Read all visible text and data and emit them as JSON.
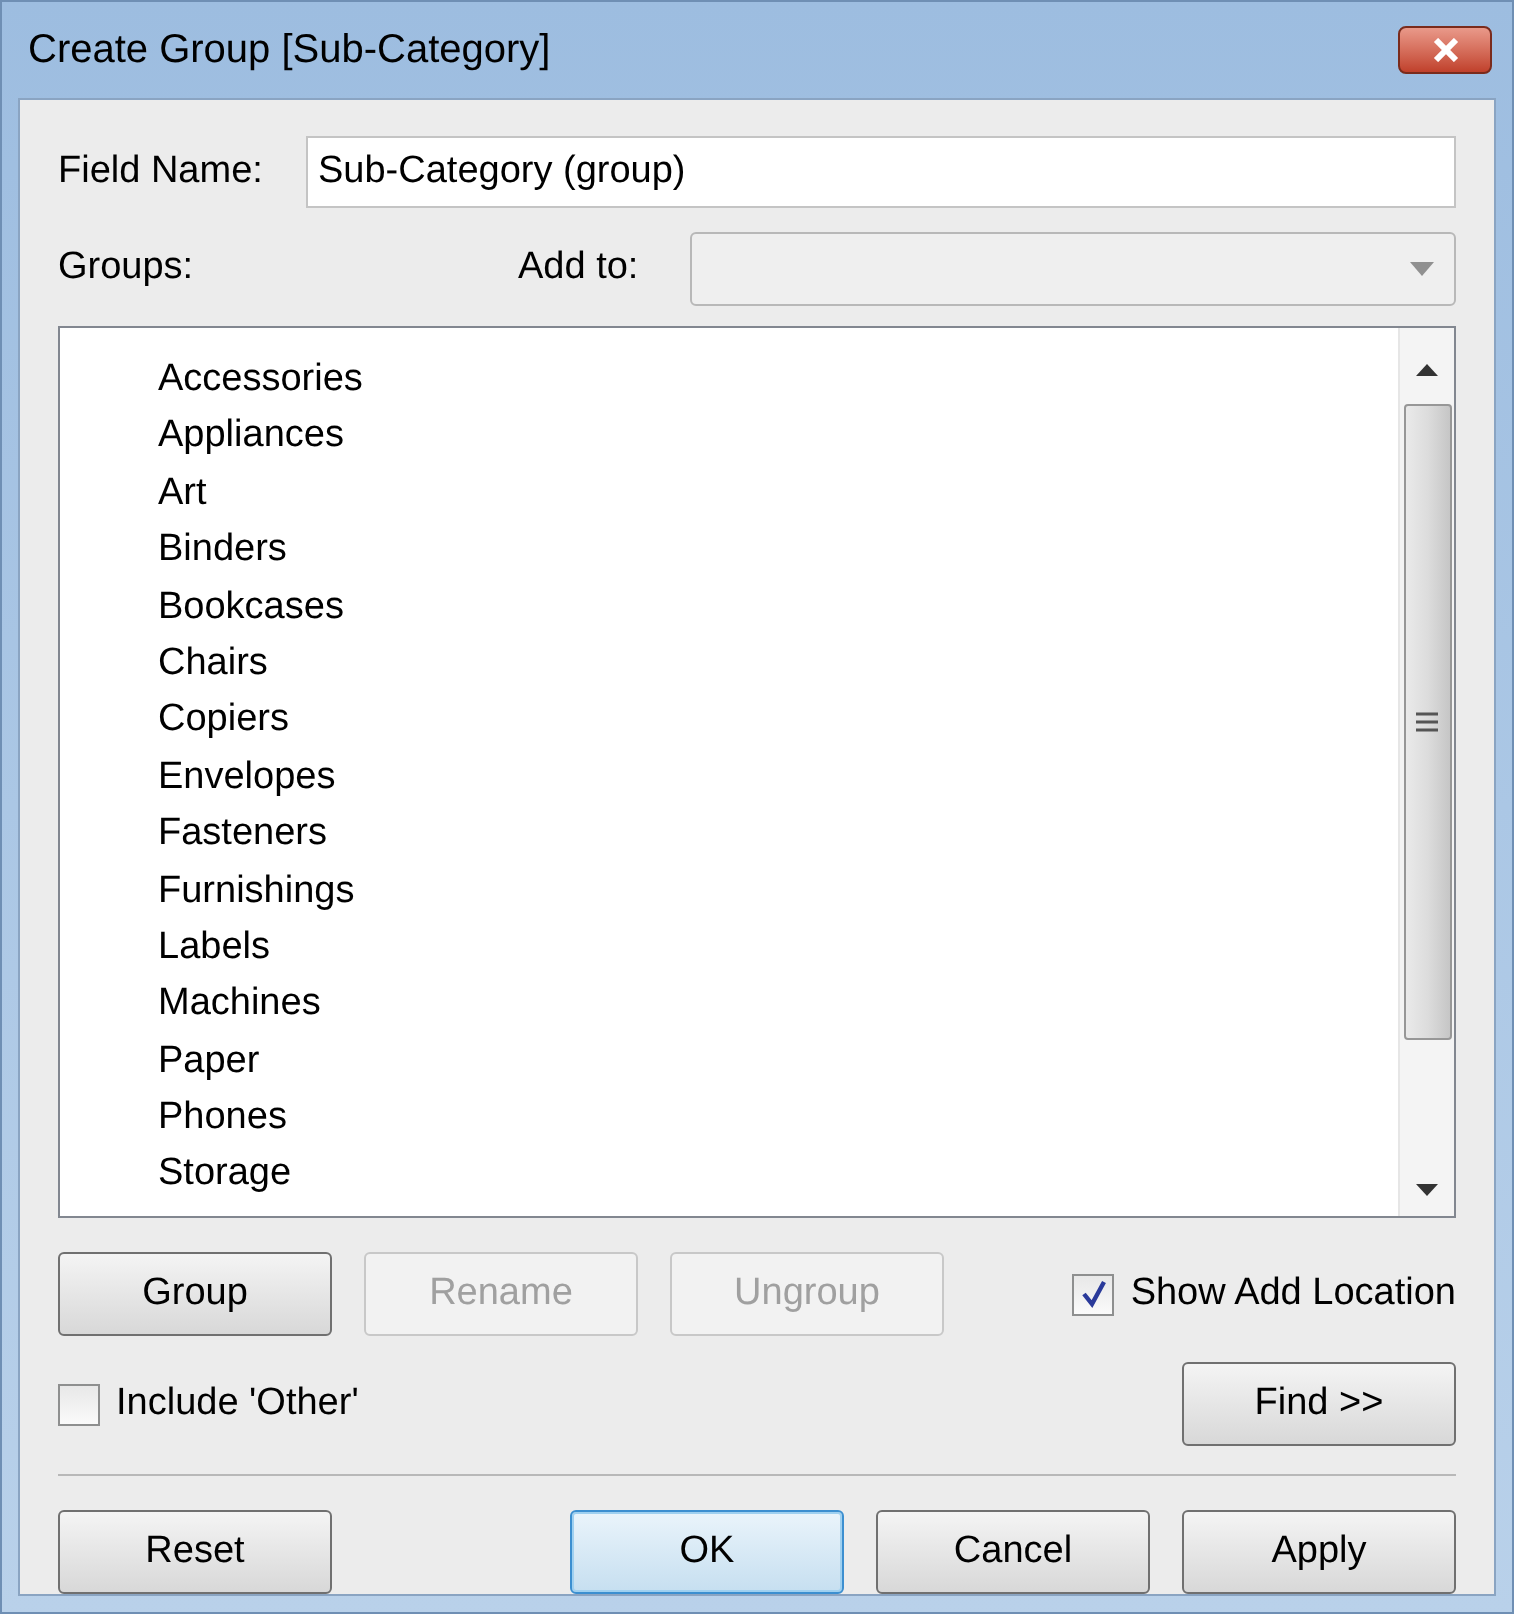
{
  "window": {
    "title": "Create Group [Sub-Category]"
  },
  "field_name": {
    "label": "Field Name:",
    "value": "Sub-Category (group)"
  },
  "groups_label": "Groups:",
  "add_to": {
    "label": "Add to:",
    "disabled": true
  },
  "list_items": [
    {
      "label": "Accessories"
    },
    {
      "label": "Appliances"
    },
    {
      "label": "Art"
    },
    {
      "label": "Binders"
    },
    {
      "label": "Bookcases"
    },
    {
      "label": "Chairs"
    },
    {
      "label": "Copiers"
    },
    {
      "label": "Envelopes"
    },
    {
      "label": "Fasteners"
    },
    {
      "label": "Furnishings"
    },
    {
      "label": "Labels"
    },
    {
      "label": "Machines"
    },
    {
      "label": "Paper"
    },
    {
      "label": "Phones"
    },
    {
      "label": "Storage"
    }
  ],
  "group_buttons": [
    {
      "label": "Group",
      "disabled": false
    },
    {
      "label": "Rename",
      "disabled": true
    },
    {
      "label": "Ungroup",
      "disabled": true
    }
  ],
  "show_add_location": {
    "label": "Show Add Location",
    "checked": true
  },
  "include_other": {
    "label": "Include 'Other'",
    "checked": false
  },
  "find_button": {
    "label": "Find >>"
  },
  "reset_button": {
    "label": "Reset"
  },
  "dialog_buttons": [
    {
      "label": "OK",
      "default": true
    },
    {
      "label": "Cancel",
      "default": false
    },
    {
      "label": "Apply",
      "default": false
    }
  ]
}
